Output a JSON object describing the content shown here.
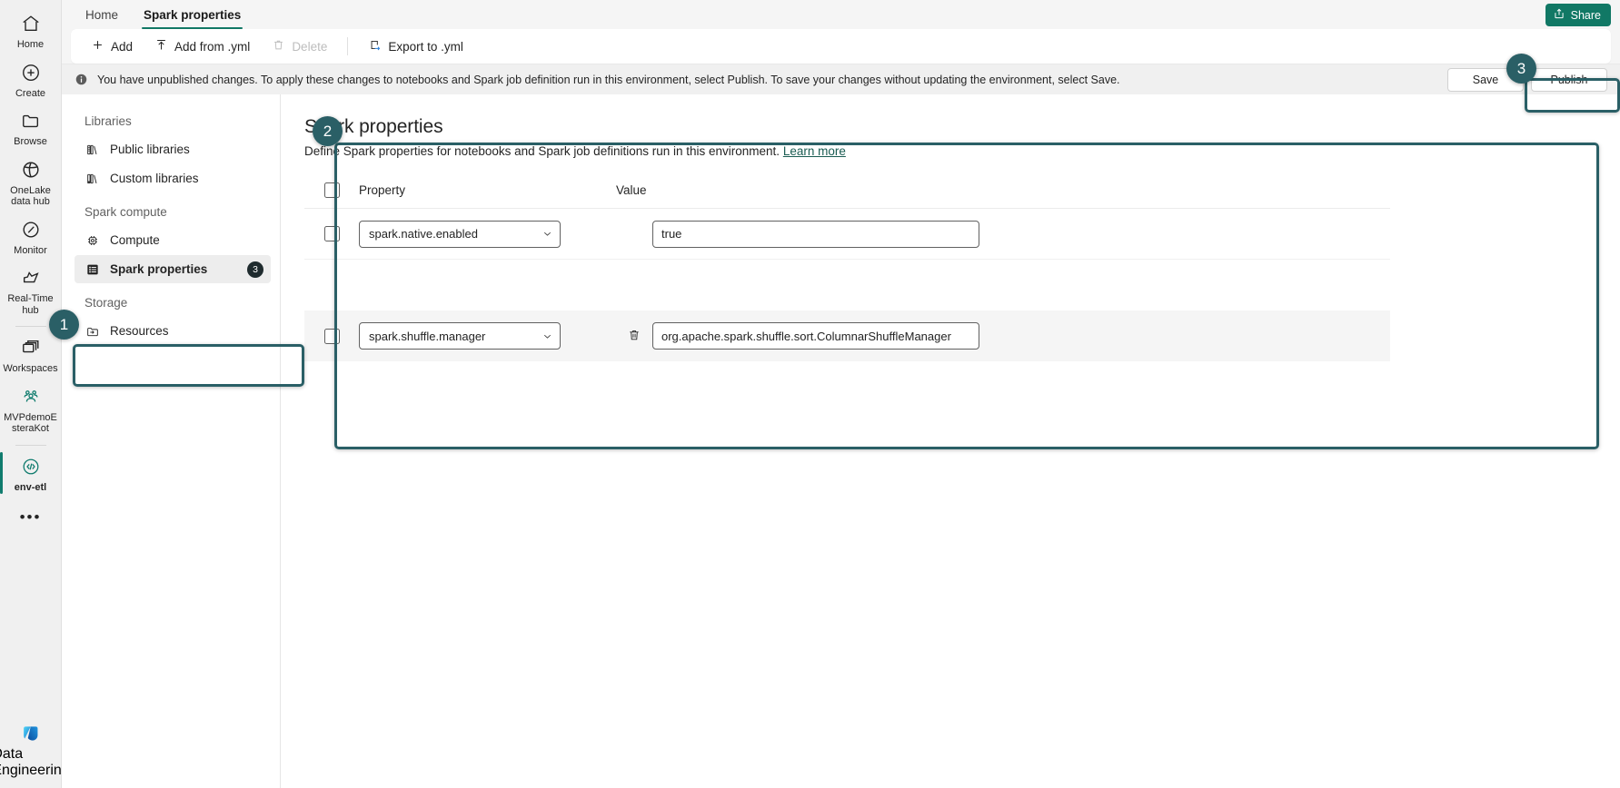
{
  "tabs": [
    {
      "label": "Home",
      "active": false
    },
    {
      "label": "Spark properties",
      "active": true
    }
  ],
  "share": {
    "label": "Share",
    "icon": "share-icon"
  },
  "toolbar": {
    "add_label": "Add",
    "add_from_yml_label": "Add from .yml",
    "delete_label": "Delete",
    "export_label": "Export to .yml"
  },
  "notice": {
    "text": "You have unpublished changes. To apply these changes to notebooks and Spark job definition run in this environment, select Publish. To save your changes without updating the environment, select Save.",
    "icon": "info-icon",
    "save_label": "Save",
    "publish_label": "Publish"
  },
  "nav": {
    "groups": [
      {
        "title": "Libraries",
        "items": [
          {
            "label": "Public libraries",
            "icon": "library-icon",
            "selected": false
          },
          {
            "label": "Custom libraries",
            "icon": "custom-library-icon",
            "selected": false
          }
        ]
      },
      {
        "title": "Spark compute",
        "items": [
          {
            "label": "Compute",
            "icon": "chip-icon",
            "selected": false
          },
          {
            "label": "Spark properties",
            "icon": "list-icon",
            "selected": true,
            "badge": "3"
          }
        ]
      },
      {
        "title": "Storage",
        "items": [
          {
            "label": "Resources",
            "icon": "resources-icon",
            "selected": false
          }
        ]
      }
    ]
  },
  "rail": {
    "items": [
      {
        "label": "Home",
        "icon": "home-icon",
        "selected": false
      },
      {
        "label": "Create",
        "icon": "plus-circle-icon",
        "selected": false
      },
      {
        "label": "Browse",
        "icon": "folder-icon",
        "selected": false
      },
      {
        "label": "OneLake data hub",
        "icon": "onelake-icon",
        "selected": false
      },
      {
        "label": "Monitor",
        "icon": "monitor-icon",
        "selected": false
      },
      {
        "label": "Real-Time hub",
        "icon": "realtime-hub-icon",
        "selected": false
      }
    ],
    "items2": [
      {
        "label": "Workspaces",
        "icon": "workspaces-icon",
        "selected": false
      },
      {
        "label": "MVPdemoEsteraKot",
        "icon": "people-icon",
        "selected": false
      }
    ],
    "items3": [
      {
        "label": "env-etl",
        "icon": "code-icon",
        "selected": true
      }
    ],
    "more_label": "•••",
    "footer": {
      "label": "Data Engineering",
      "icon": "fabric-icon"
    }
  },
  "main": {
    "title": "Spark properties",
    "description": "Define Spark properties for notebooks and Spark job definitions run in this environment.",
    "learn_more": "Learn more",
    "table": {
      "headers": {
        "property": "Property",
        "value": "Value"
      },
      "rows": [
        {
          "property": "spark.native.enabled",
          "value": "true",
          "checked": false,
          "deletable": false,
          "highlight": false
        },
        {
          "property": "spark.shuffle.manager",
          "value": "org.apache.spark.shuffle.sort.ColumnarShuffleManager",
          "checked": false,
          "deletable": true,
          "delete_icon": "trash-icon",
          "highlight": true
        }
      ]
    }
  },
  "annotations": [
    {
      "number": "1",
      "target": "nav-spark-properties"
    },
    {
      "number": "2",
      "target": "main-panel"
    },
    {
      "number": "3",
      "target": "publish-button"
    }
  ],
  "colors": {
    "accent_teal": "#117865",
    "annotation_teal": "#2a5f66",
    "badge_dark": "#1f2b2e",
    "link": "#1a5c52"
  }
}
